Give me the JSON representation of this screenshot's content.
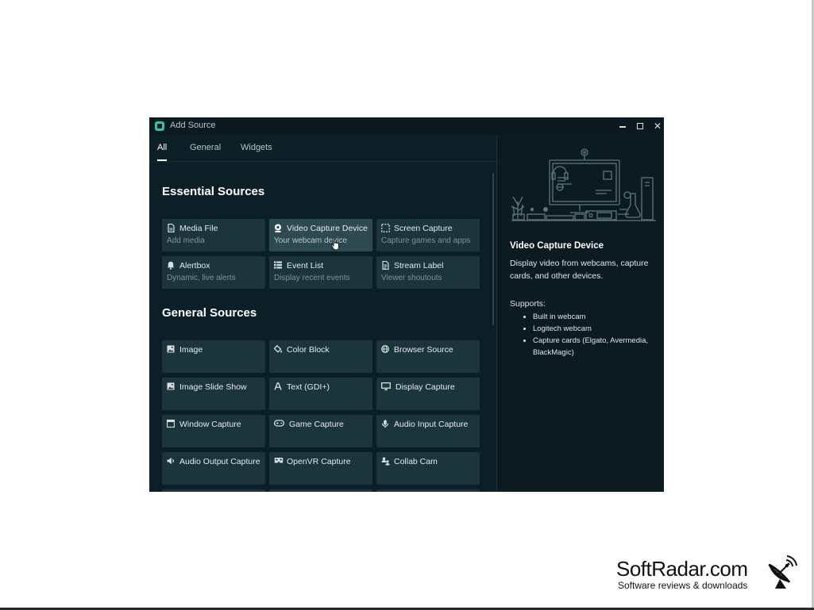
{
  "window": {
    "title": "Add Source",
    "controls": {
      "minimize": "",
      "maximize": "",
      "close": "✕"
    }
  },
  "tabs": [
    {
      "label": "All",
      "active": true
    },
    {
      "label": "General",
      "active": false
    },
    {
      "label": "Widgets",
      "active": false
    }
  ],
  "sections": {
    "essential": {
      "title": "Essential Sources",
      "cards": [
        {
          "icon": "file-icon",
          "title": "Media File",
          "subtitle": "Add media"
        },
        {
          "icon": "webcam-icon",
          "title": "Video Capture Device",
          "subtitle": "Your webcam device",
          "active": true
        },
        {
          "icon": "screen-capture-icon",
          "title": "Screen Capture",
          "subtitle": "Capture games and apps"
        },
        {
          "icon": "bell-icon",
          "title": "Alertbox",
          "subtitle": "Dynamic, live alerts"
        },
        {
          "icon": "list-icon",
          "title": "Event List",
          "subtitle": "Display recent events"
        },
        {
          "icon": "label-icon",
          "title": "Stream Label",
          "subtitle": "Viewer shoutouts"
        }
      ]
    },
    "general": {
      "title": "General Sources",
      "cards": [
        {
          "icon": "image-icon",
          "title": "Image"
        },
        {
          "icon": "paint-bucket-icon",
          "title": "Color Block"
        },
        {
          "icon": "globe-icon",
          "title": "Browser Source"
        },
        {
          "icon": "image-icon",
          "title": "Image Slide Show"
        },
        {
          "icon": "text-icon",
          "title": "Text (GDI+)"
        },
        {
          "icon": "monitor-icon",
          "title": "Display Capture"
        },
        {
          "icon": "window-icon",
          "title": "Window Capture"
        },
        {
          "icon": "gamepad-icon",
          "title": "Game Capture"
        },
        {
          "icon": "microphone-icon",
          "title": "Audio Input Capture"
        },
        {
          "icon": "speaker-icon",
          "title": "Audio Output Capture"
        },
        {
          "icon": "vr-headset-icon",
          "title": "OpenVR Capture"
        },
        {
          "icon": "people-icon",
          "title": "Collab Cam"
        }
      ]
    }
  },
  "detail": {
    "title": "Video Capture Device",
    "description": "Display video from webcams, capture cards, and other devices.",
    "supports_label": "Supports:",
    "supports": [
      "Built in webcam",
      "Logitech webcam",
      "Capture cards (Elgato, Avermedia, BlackMagic)"
    ]
  },
  "colors": {
    "window_bg": "#0c1f26",
    "card_bg": "#1c343c",
    "card_active_bg": "#2d4a53",
    "accent": "#31c3a2"
  },
  "watermark": {
    "brand": "SoftRadar.com",
    "tagline": "Software reviews & downloads"
  }
}
